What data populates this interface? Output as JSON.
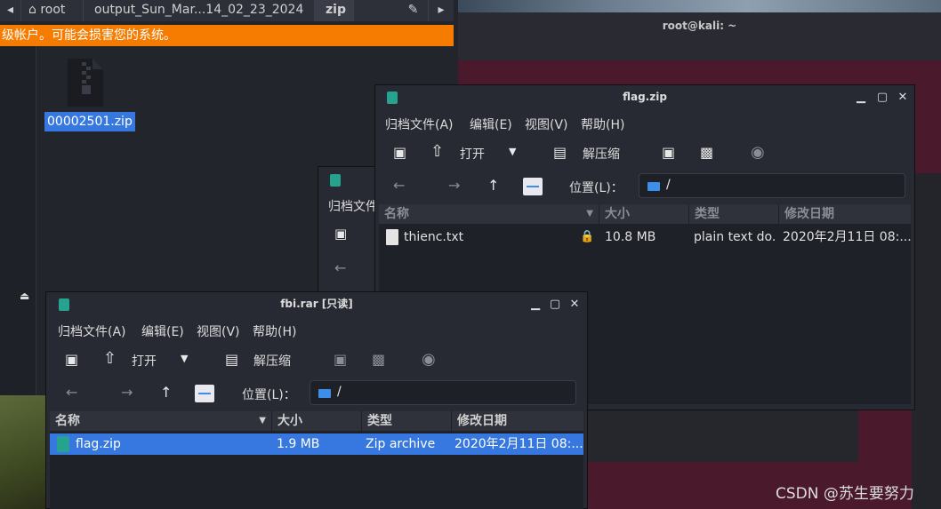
{
  "file_manager": {
    "tabs": [
      "root",
      "output_Sun_Mar...14_02_23_2024",
      "zip"
    ],
    "warning": "级帐户。可能会损害您的系统。",
    "file": "00002501.zip"
  },
  "terminal": {
    "title": "root@kali: ~"
  },
  "win_partial": {
    "menu_fragment": "归档文件"
  },
  "win_flag": {
    "title": "flag.zip",
    "menu": [
      "归档文件(A)",
      "编辑(E)",
      "视图(V)",
      "帮助(H)"
    ],
    "open": "打开",
    "extract": "解压缩",
    "location_label": "位置(L)：",
    "location": "/",
    "columns": [
      "名称",
      "大小",
      "类型",
      "修改日期"
    ],
    "rows": [
      {
        "name": "thienc.txt",
        "size": "10.8 MB",
        "type": "plain text do...",
        "date": "2020年2月11日 08:..."
      }
    ]
  },
  "win_fbi": {
    "title": "fbi.rar [只读]",
    "menu": [
      "归档文件(A)",
      "编辑(E)",
      "视图(V)",
      "帮助(H)"
    ],
    "open": "打开",
    "extract": "解压缩",
    "location_label": "位置(L)：",
    "location": "/",
    "columns": [
      "名称",
      "大小",
      "类型",
      "修改日期"
    ],
    "rows": [
      {
        "name": "flag.zip",
        "size": "1.9 MB",
        "type": "Zip archive",
        "date": "2020年2月11日 08:..."
      }
    ]
  },
  "watermark": "CSDN @苏生要努力",
  "colors": {
    "accent": "#3778e0",
    "warning": "#f57c00",
    "app_icon": "#26a38f"
  }
}
